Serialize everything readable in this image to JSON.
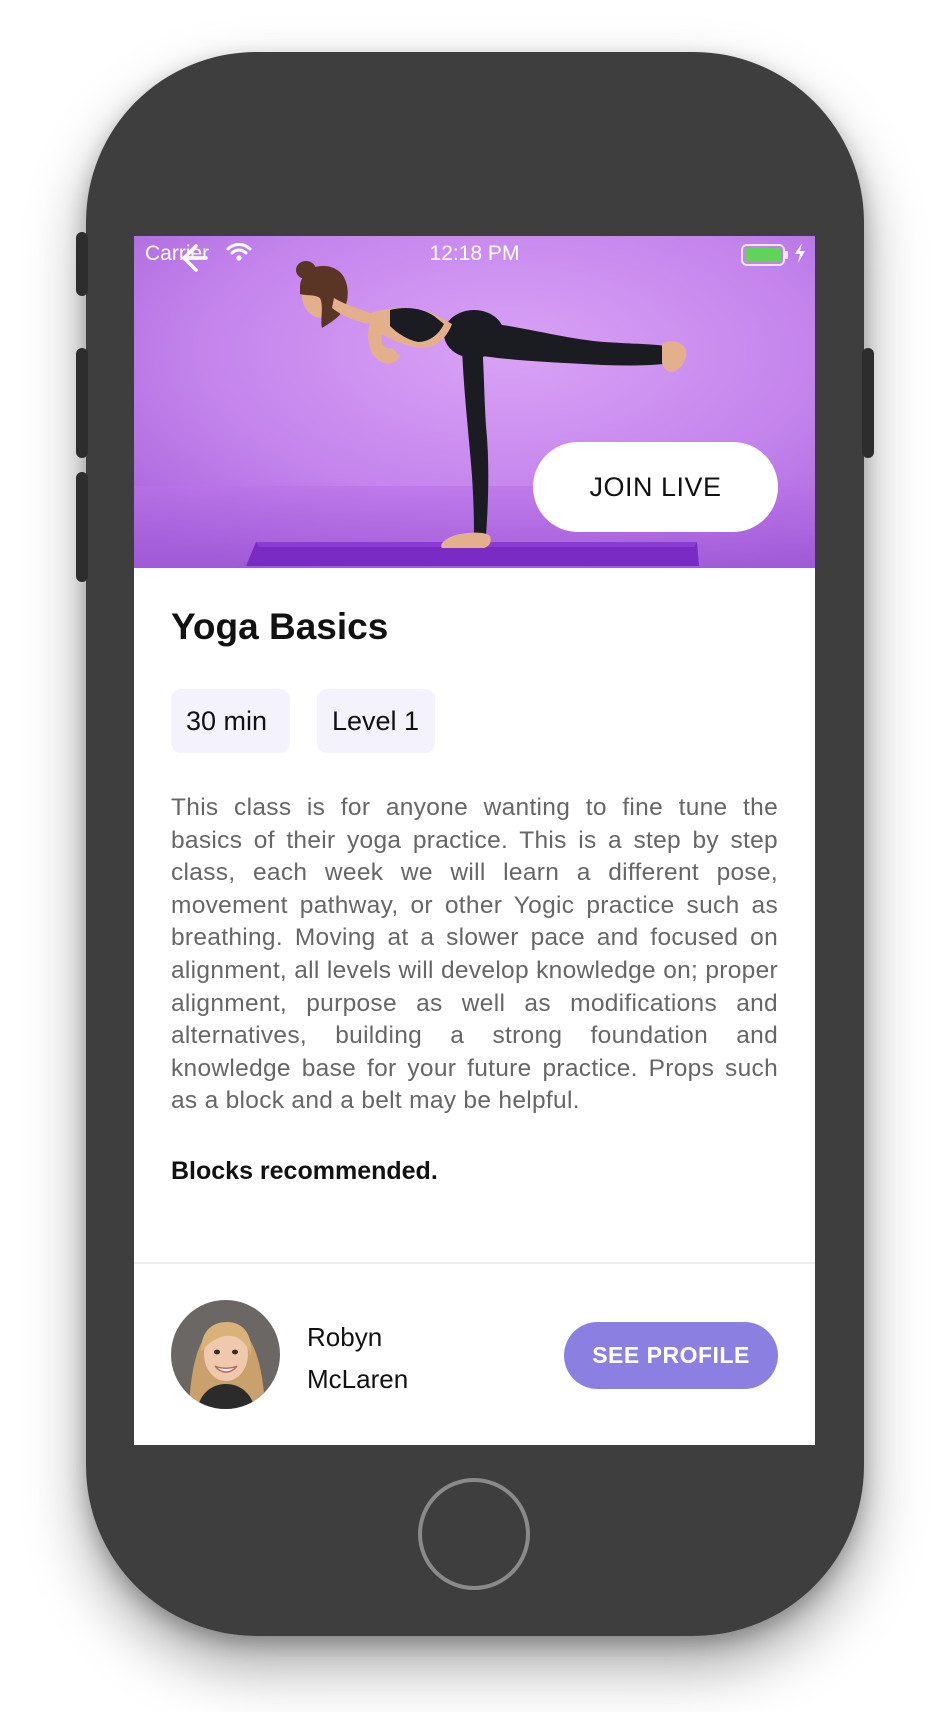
{
  "status_bar": {
    "carrier": "Carrier",
    "time": "12:18 PM"
  },
  "hero": {
    "join_label": "JOIN LIVE"
  },
  "class": {
    "title": "Yoga Basics",
    "tags": [
      "30 min",
      "Level 1"
    ],
    "description": "This class is for anyone wanting to fine tune the basics of their yoga practice. This is a step by step class, each week we will learn a different pose, movement pathway, or other Yogic practice such as breathing. Moving at a slower pace and focused on alignment, all levels will develop knowledge on; proper alignment, purpose as well as modifications and alternatives, building a strong foundation and knowledge base for your future practice. Props such as a block and a belt may be helpful.",
    "note": "Blocks recommended."
  },
  "instructor": {
    "name": "Robyn McLaren",
    "profile_label": "SEE PROFILE"
  },
  "colors": {
    "hero_background": "#c98af0",
    "tag_background": "#f4f2fd",
    "profile_button": "#8b80e2",
    "battery": "#5fd35a",
    "device_body": "#3e3e3e"
  }
}
